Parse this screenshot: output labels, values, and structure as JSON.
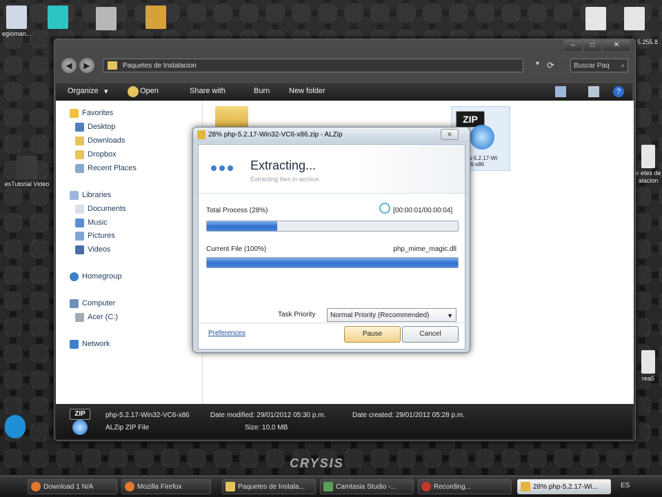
{
  "desktop": {
    "icons": [
      {
        "label": "",
        "color": "#cfd8e6"
      },
      {
        "label": "",
        "color": "#2ec4c4"
      },
      {
        "label": "",
        "color": "#d6a13a"
      },
      {
        "label": "",
        "color": "#e0e0e0"
      },
      {
        "label": "",
        "color": "#e0e0e0"
      }
    ],
    "left_labels": [
      "egioman...",
      "esTutorial Video"
    ],
    "right_labels": [
      "5.255.8",
      "e etes de",
      "alacion",
      "rea5"
    ],
    "brand": "CRYSIS"
  },
  "explorer": {
    "address": "Paquetes de Instalacion",
    "search_placeholder": "Buscar Paq",
    "toolbar": {
      "organize": "Organize",
      "open": "Open",
      "share_with": "Share with",
      "burn": "Burn",
      "new_folder": "New folder"
    },
    "nav": {
      "favorites": "Favorites",
      "desktop": "Desktop",
      "downloads": "Downloads",
      "dropbox": "Dropbox",
      "recent": "Recent Places",
      "libraries": "Libraries",
      "documents": "Documents",
      "music": "Music",
      "pictures": "Pictures",
      "videos": "Videos",
      "homegroup": "Homegroup",
      "computer": "Computer",
      "drive": "Acer (C:)",
      "network": "Network"
    },
    "selected_file_label": "php-5.2.17-Wi\nVC6-x86",
    "details": {
      "name": "php-5.2.17-Win32-VC6-x86",
      "type": "ALZip ZIP File",
      "date_modified": "Date modified: 29/01/2012 05:30 p.m.",
      "date_created": "Date created: 29/01/2012 05:28 p.m.",
      "size": "Size: 10,0 MB",
      "badge": "ZIP"
    }
  },
  "dialog": {
    "title": "28% php-5.2.17-Win32-VC6-x86.zip - ALZip",
    "close": "✕",
    "heading": "Extracting...",
    "subheading": "Extracting files in archive.",
    "total_label": "Total Process (28%)",
    "total_progress": 0.28,
    "time": "[00:00:01/00:00:04]",
    "current_label": "Current File (100%)",
    "current_file": "php_mime_magic.dll",
    "current_progress": 1.0,
    "priority_label": "Task Priority",
    "priority_value": "Normal Priority (Recommended)",
    "preferences": "Preferences",
    "pause": "Pause",
    "cancel": "Cancel"
  },
  "taskbar": {
    "items": [
      {
        "label": "Download 1 N/A",
        "color": "#e07a2c"
      },
      {
        "label": "Mozilla Firefox",
        "color": "#e07a2c"
      },
      {
        "label": "Paquetes de Instala...",
        "color": "#e6c45c"
      },
      {
        "label": "Camtasia Studio -...",
        "color": "#5aa05a"
      },
      {
        "label": "Recording...",
        "color": "#c0392b"
      },
      {
        "label": "28% php-5.2.17-Wi...",
        "color": "#e3b53e"
      }
    ],
    "lang": "ES"
  }
}
